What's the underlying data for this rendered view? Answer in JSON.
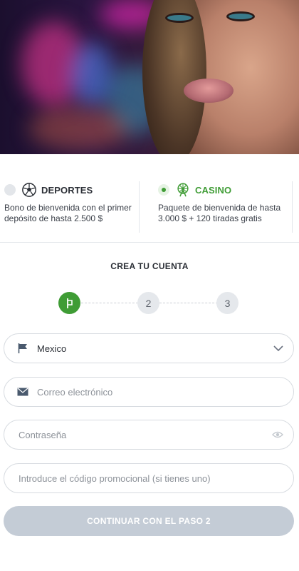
{
  "bonuses": [
    {
      "title": "DEPORTES",
      "icon": "soccer-ball-icon",
      "selected": false,
      "description": "Bono de bienvenida con el primer depósito de hasta 2.500 $"
    },
    {
      "title": "CASINO",
      "icon": "ferris-wheel-icon",
      "selected": true,
      "description": "Paquete de bienvenida de hasta 3.000 $ + 120 tiradas gratis"
    }
  ],
  "register": {
    "title": "CREA TU CUENTA",
    "steps": [
      "1",
      "2",
      "3"
    ],
    "current_step": 1,
    "country": "Mexico",
    "email_placeholder": "Correo electrónico",
    "password_placeholder": "Contraseña",
    "promo_placeholder": "Introduce el código promocional (si tienes uno)",
    "submit_label": "CONTINUAR CON EL PASO 2"
  },
  "colors": {
    "accent": "#3f9c35",
    "disabled_button": "#c4ccd6"
  }
}
